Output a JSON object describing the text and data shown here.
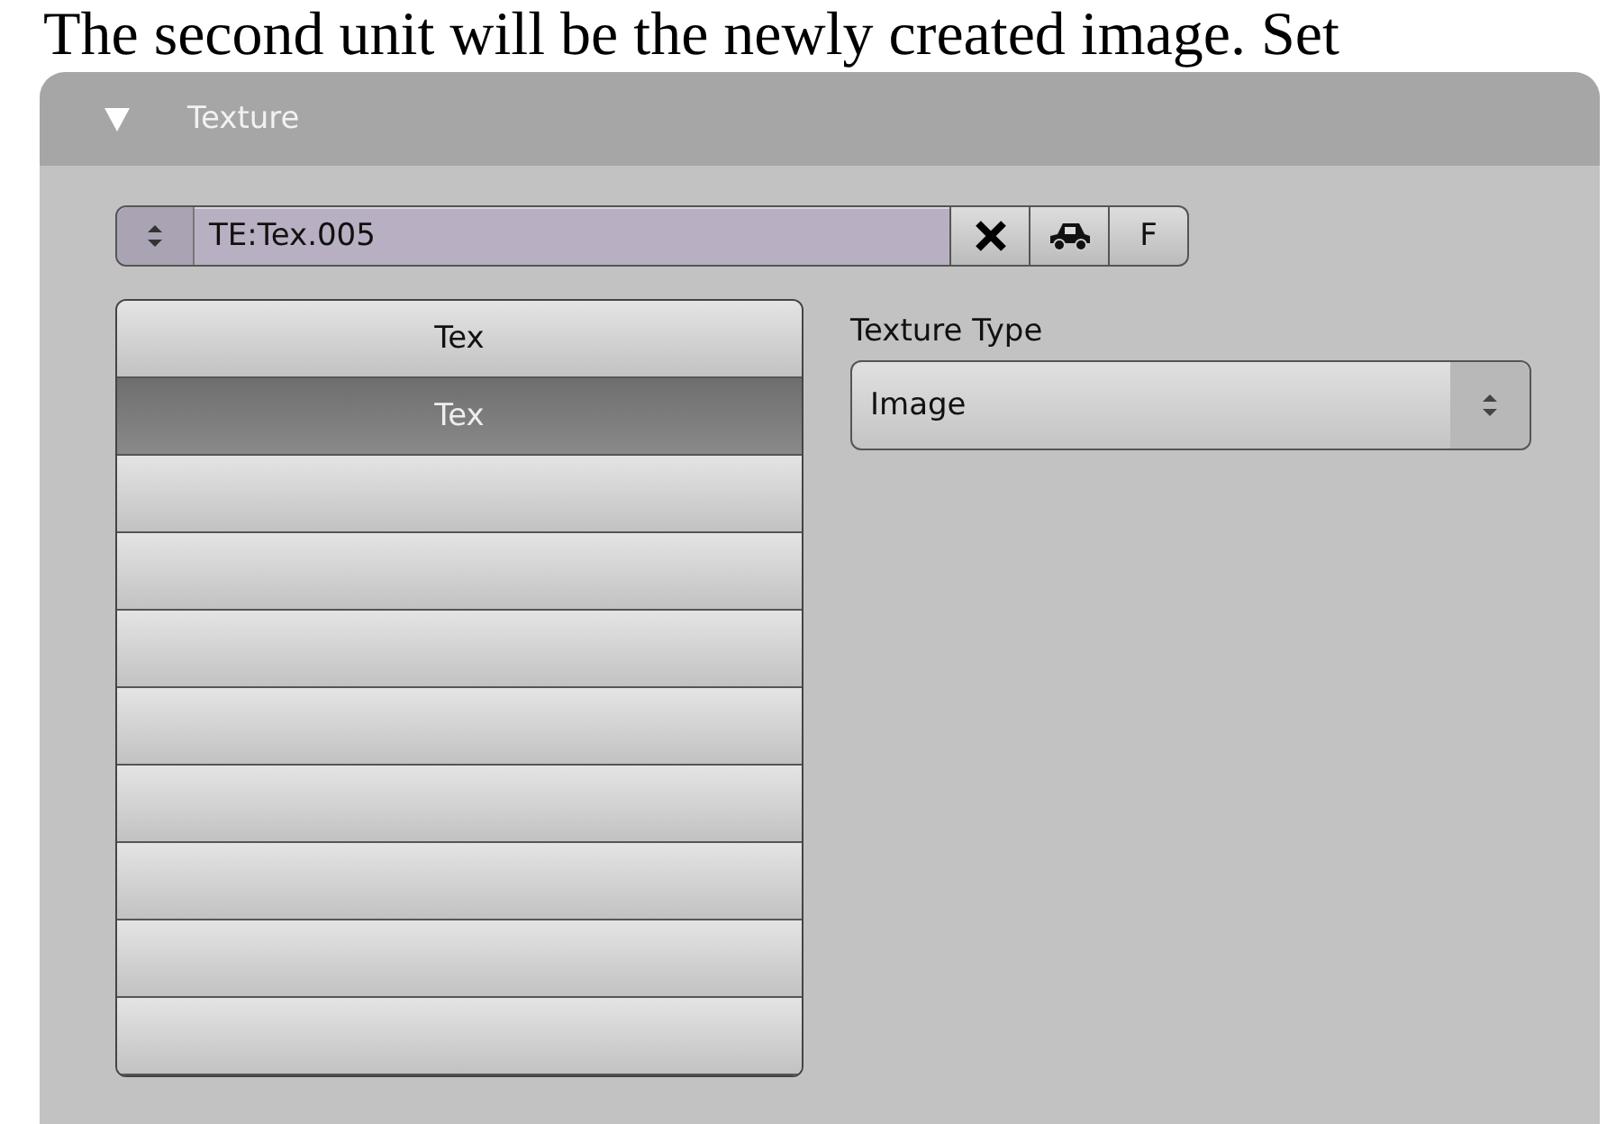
{
  "caption": "The second unit will be the newly created image. Set",
  "panel": {
    "title": "Texture",
    "expanded": true
  },
  "datablock": {
    "name": "TE:Tex.005",
    "fake_user": "F"
  },
  "texture_slots": [
    {
      "label": "Tex",
      "selected": false
    },
    {
      "label": "Tex",
      "selected": true
    },
    {
      "selected": false
    },
    {
      "selected": false
    },
    {
      "selected": false
    },
    {
      "selected": false
    },
    {
      "selected": false
    },
    {
      "selected": false
    },
    {
      "selected": false
    },
    {
      "selected": false
    }
  ],
  "texture_type": {
    "label": "Texture Type",
    "value": "Image"
  }
}
